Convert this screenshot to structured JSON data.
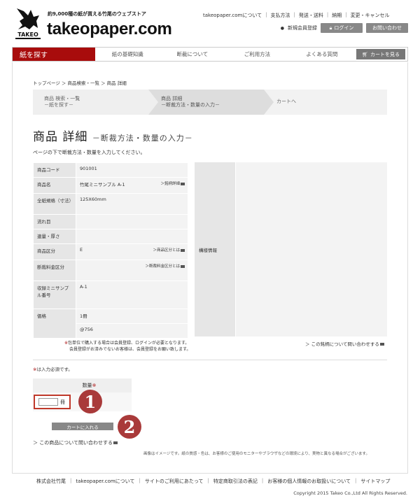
{
  "header": {
    "tagline": "約9,000種の紙が買える竹尾のウェブストア",
    "site_name": "takeopaper.com",
    "logo_text": "TAKEO",
    "top_links": [
      "takeopaper.comについて",
      "支払方法",
      "発送・送料",
      "納期",
      "変更・キャンセル"
    ],
    "register": "新規会員登録",
    "login": "ログイン",
    "contact": "お問い合わせ"
  },
  "nav": {
    "search": "紙を探す",
    "items": [
      "紙の基礎知識",
      "断裁について",
      "ご利用方法",
      "よくある質問"
    ],
    "cart": "カートを見る"
  },
  "breadcrumb": "トップページ ＞ 商品検索・一覧 ＞ 商品 詳細",
  "steps": [
    {
      "line1": "商品 検索・一覧",
      "line2": "－紙を探す－"
    },
    {
      "line1": "商品 詳細",
      "line2": "－断裁方法・数量の入力－"
    },
    {
      "line1": "カートへ",
      "line2": ""
    }
  ],
  "page_title": "商品 詳細",
  "page_subtitle": "－断裁方法・数量の入力－",
  "instruction": "ページの下で断裁方法・数量を入力してください。",
  "product": {
    "code_label": "商品コード",
    "code": "901001",
    "name_label": "商品名",
    "name": "竹尾ミニサンプル A-1",
    "name_link": "＞銘柄詳細",
    "size_label": "全紙規格（寸法）",
    "size": "125X60mm",
    "grain_label": "流れ目",
    "grain": "",
    "weight_label": "連量・厚さ",
    "weight": "",
    "category_label": "商品区分",
    "category": "E",
    "category_link": "＞商品区分とは",
    "cutfee_label": "断裁料金区分",
    "cutfee": "",
    "cutfee_link": "＞断裁料金区分とは",
    "contents_label": "収録ミニサンプル番号",
    "contents": "A-1",
    "price_label": "価格",
    "unit": "1冊",
    "price": "@756"
  },
  "side_panel": {
    "label": "構様情報"
  },
  "notes": [
    "包単位で購入する場合は会員登録、ログインが必要となります。",
    "会員登録がお済みでないお客様は、会員登録をお願い致します。"
  ],
  "note_mark": "※",
  "inquiry_brand": "＞ この銘柄について問い合わせする",
  "required_note": "は入力必須です。",
  "required_mark": "※",
  "quantity": {
    "label": "数量",
    "mark": "※",
    "unit": "冊",
    "value": ""
  },
  "circle1": "1",
  "circle2": "2",
  "add_cart": "カートに入れる",
  "inquiry_product": "＞ この商品について問い合わせする",
  "image_note": "画像はイメージです。紙の質感・色は、お客様のご使用のモニターやブラウザなどの環境により、実物と異なる場合がございます。",
  "footer": {
    "links": [
      "株式会社竹尾",
      "takeopaper.comについて",
      "サイトのご利用にあたって",
      "特定商取引法の表記",
      "お客様の個人情報のお取扱いについて",
      "サイトマップ"
    ],
    "copyright": "Copyright 2015 Takeo Co.,Ltd All Rights Reserved."
  },
  "colors": {
    "brand_red": "#a80c0c",
    "circle": "#a93a3a",
    "button_gray": "#888888"
  }
}
